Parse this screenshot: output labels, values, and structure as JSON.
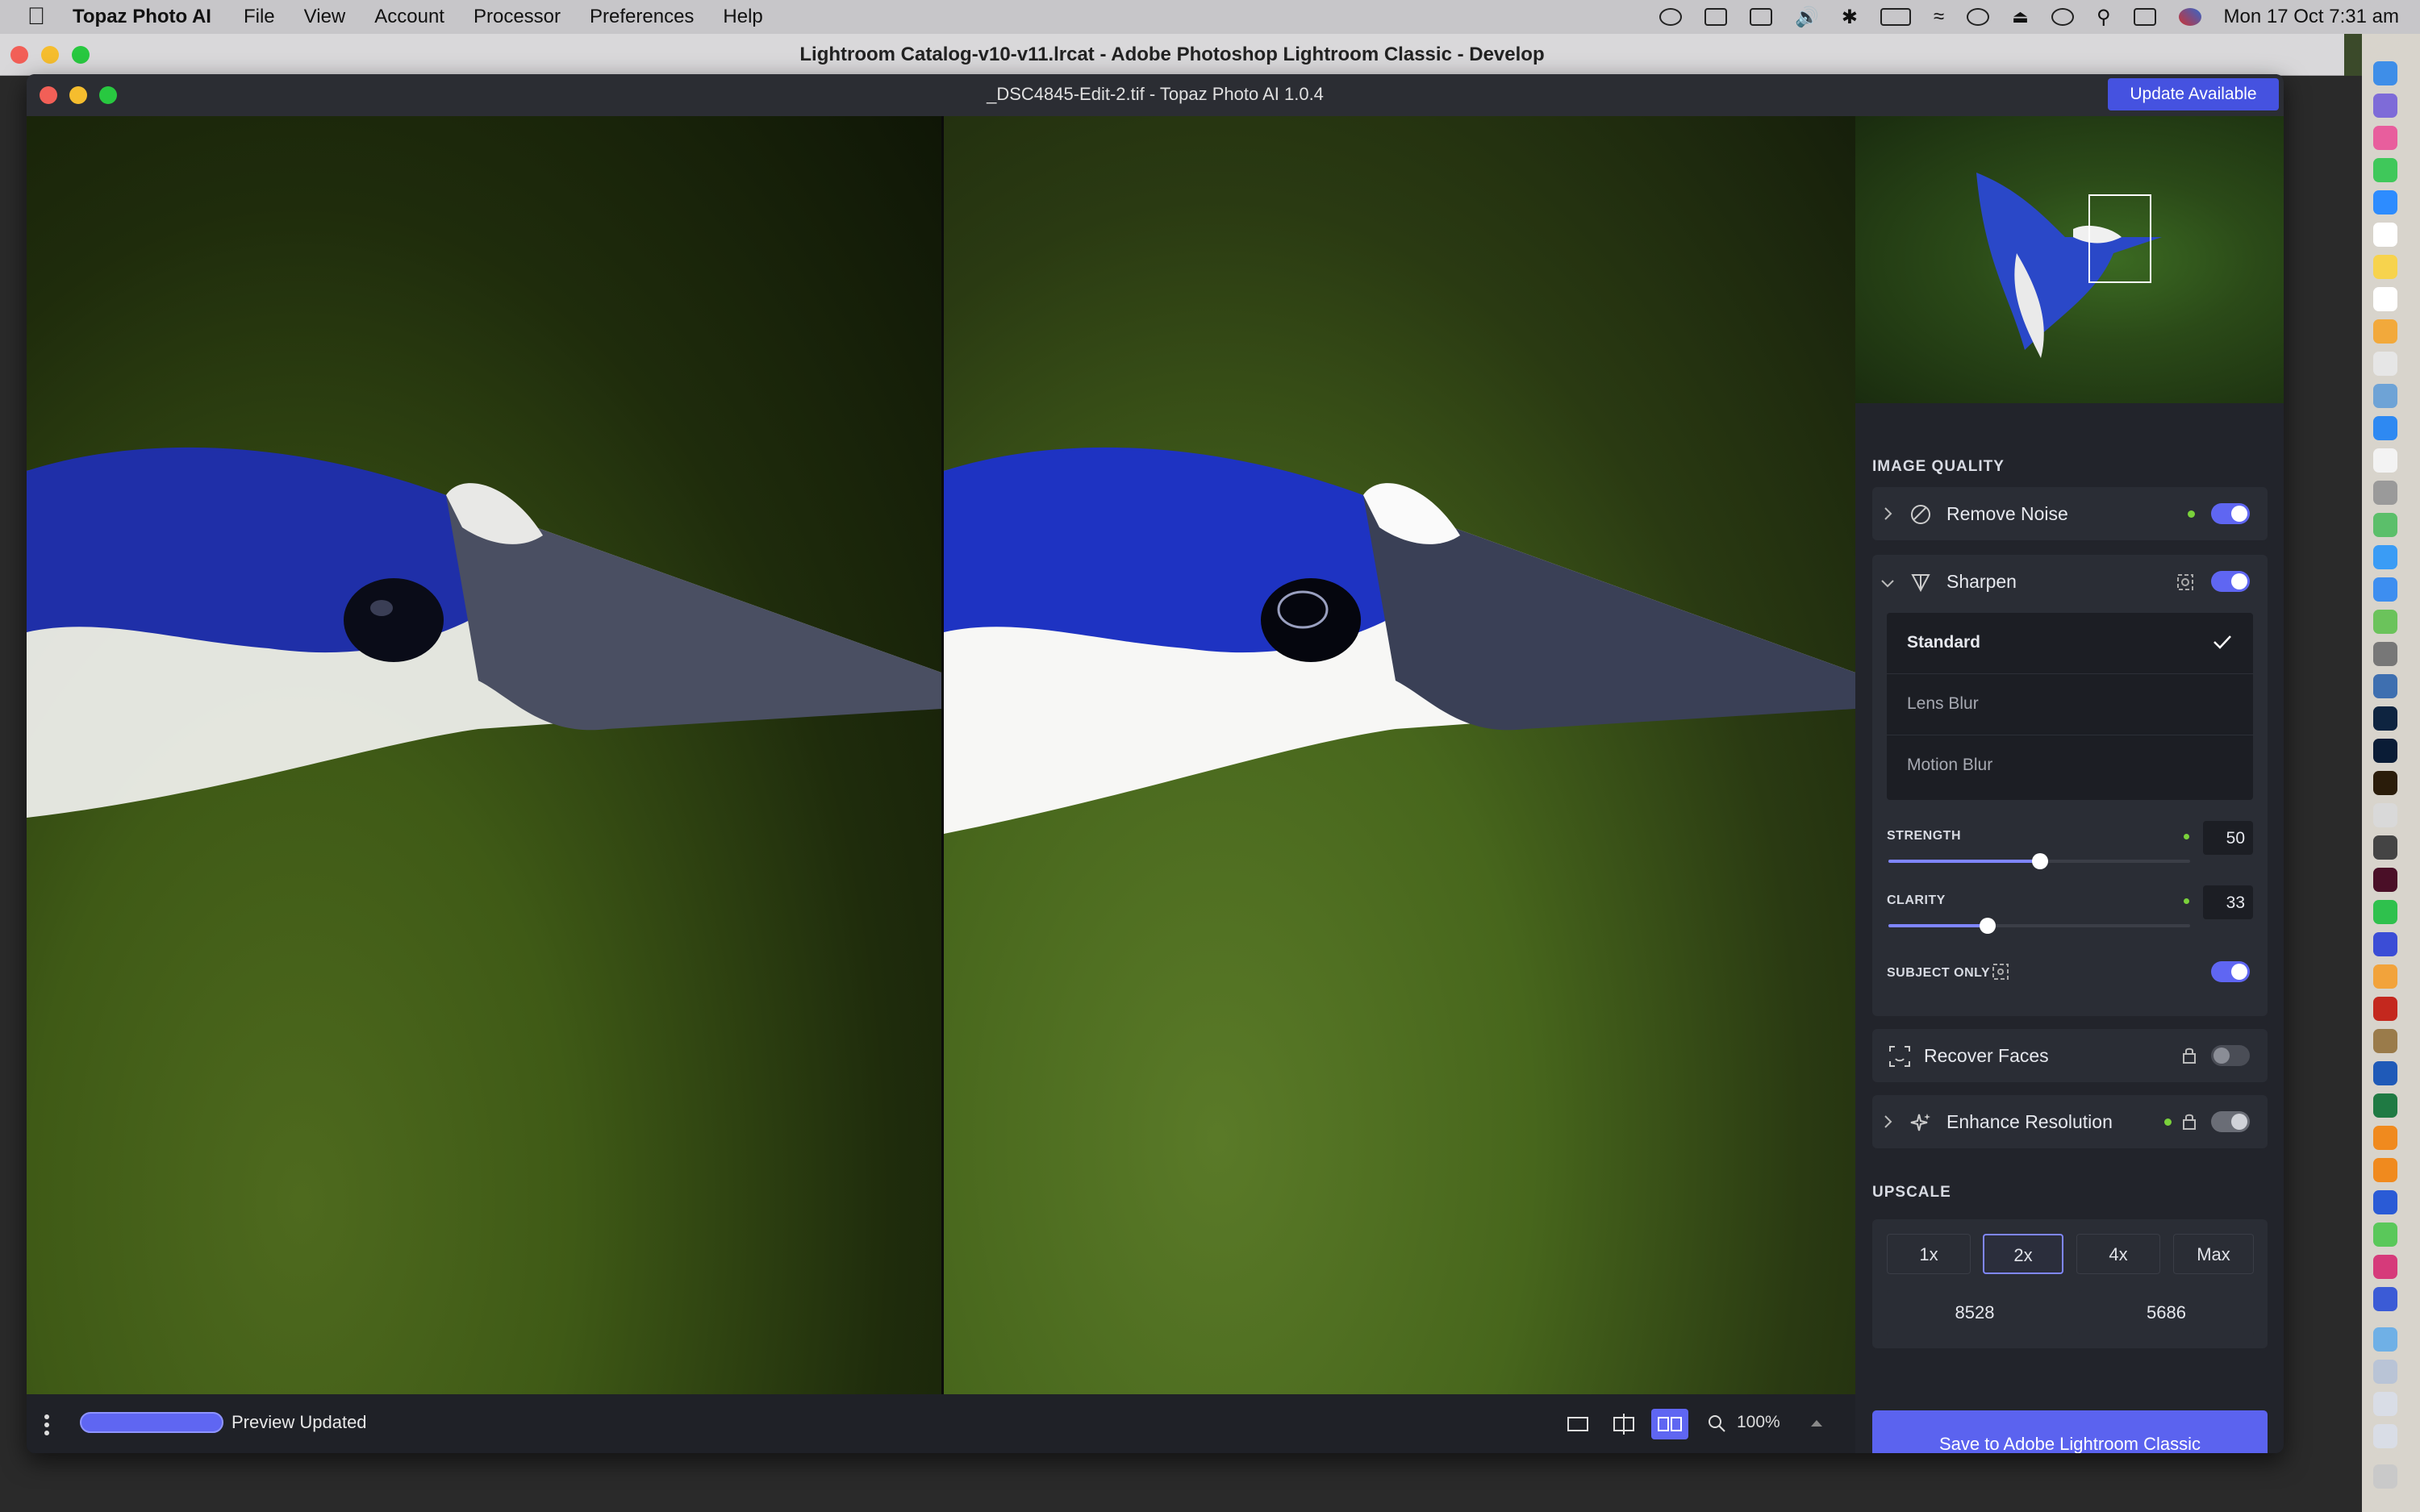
{
  "menubar": {
    "app_name": "Topaz Photo AI",
    "items": [
      "File",
      "View",
      "Account",
      "Processor",
      "Preferences",
      "Help"
    ],
    "clock": "Mon 17 Oct  7:31 am"
  },
  "lightroom_window": {
    "title": "Lightroom Catalog-v10-v11.lrcat - Adobe Photoshop Lightroom Classic - Develop"
  },
  "topaz_window": {
    "title": "_DSC4845-Edit-2.tif - Topaz Photo AI 1.0.4",
    "update_label": "Update Available"
  },
  "bottom_bar": {
    "status": "Preview Updated",
    "zoom": "100%",
    "progress": 1.0
  },
  "panel": {
    "image_quality_title": "IMAGE QUALITY",
    "remove_noise": {
      "label": "Remove Noise",
      "enabled": true
    },
    "sharpen": {
      "label": "Sharpen",
      "enabled": true,
      "modes": [
        "Standard",
        "Lens Blur",
        "Motion Blur"
      ],
      "selected_mode": "Standard",
      "strength_label": "STRENGTH",
      "strength": "50",
      "clarity_label": "CLARITY",
      "clarity": "33",
      "subject_only_label": "SUBJECT ONLY",
      "subject_only": true
    },
    "recover_faces": {
      "label": "Recover Faces",
      "enabled": false
    },
    "enhance_resolution": {
      "label": "Enhance Resolution",
      "enabled": true
    },
    "upscale_title": "UPSCALE",
    "upscale_options": [
      "1x",
      "2x",
      "4x",
      "Max"
    ],
    "upscale_selected": "2x",
    "width": "8528",
    "height": "5686",
    "save_label": "Save to Adobe Lightroom Classic"
  },
  "colors": {
    "accent": "#5f66f2",
    "status_green": "#7ad13b"
  }
}
